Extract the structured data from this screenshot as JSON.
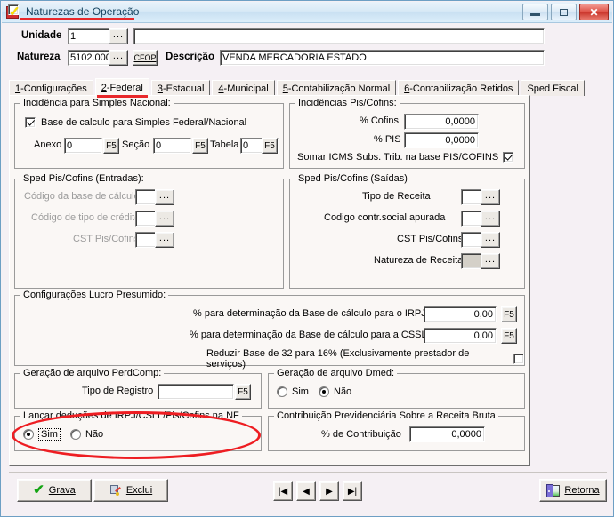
{
  "window": {
    "title": "Naturezas de Operação",
    "icon": "checkmark-flag-icon",
    "minimize_label": "Minimizar",
    "maximize_label": "Maximizar",
    "close_label": "Fechar",
    "accent_red": "#e8282b"
  },
  "header": {
    "unidade_label": "Unidade",
    "unidade_value": "1",
    "unidade_browse": "...",
    "unidade_desc_value": "",
    "natureza_label": "Natureza",
    "natureza_value": "5102.000",
    "natureza_browse": "...",
    "cfop_button": "CFOP",
    "descricao_label": "Descrição",
    "descricao_value": "VENDA MERCADORIA ESTADO"
  },
  "tabs": [
    {
      "num": "1",
      "label": "-Configurações",
      "active": false
    },
    {
      "num": "2",
      "label": "-Federal",
      "active": true
    },
    {
      "num": "3",
      "label": "-Estadual",
      "active": false
    },
    {
      "num": "4",
      "label": "-Municipal",
      "active": false
    },
    {
      "num": "5",
      "label": "-Contabilização Normal",
      "active": false
    },
    {
      "num": "6",
      "label": "-Contabilização Retidos",
      "active": false
    },
    {
      "num": "",
      "label": "Sped Fiscal",
      "active": false
    }
  ],
  "simples_nacional": {
    "legend": "Incidência para Simples Nacional:",
    "base_calculo_label": "Base de calculo para Simples Federal/Nacional",
    "base_calculo_checked": true,
    "anexo_label": "Anexo",
    "anexo_value": "0",
    "anexo_f5": "F5",
    "secao_label": "Seção",
    "secao_value": "0",
    "secao_f5": "F5",
    "tabela_label": "Tabela",
    "tabela_value": "0",
    "tabela_f5": "F5"
  },
  "pis_cofins": {
    "legend": "Incidências Pis/Cofins:",
    "cofins_label": "% Cofins",
    "cofins_value": "0,0000",
    "pis_label": "% PIS",
    "pis_value": "0,0000",
    "somar_label": "Somar ICMS Subs. Trib. na base PIS/COFINS",
    "somar_checked": true
  },
  "sped_entradas": {
    "legend": "Sped Pis/Cofins (Entradas):",
    "base_calc_label": "Código da base de cálculo",
    "base_calc_value": "",
    "tipo_credito_label": "Código de tipo de crédito",
    "tipo_credito_value": "",
    "cst_label": "CST Pis/Cofins",
    "cst_value": "",
    "browse": "...",
    "disabled": true
  },
  "sped_saidas": {
    "legend": "Sped Pis/Cofins (Saídas)",
    "tipo_receita_label": "Tipo de Receita",
    "tipo_receita_value": "",
    "codigo_contr_label": "Codigo contr.social apurada",
    "codigo_contr_value": "",
    "cst_label": "CST Pis/Cofins",
    "cst_value": "",
    "natureza_receita_label": "Natureza de Receita",
    "natureza_receita_value": "",
    "browse": "..."
  },
  "lucro_presumido": {
    "legend": "Configurações Lucro Presumido:",
    "irpj_label": "% para determinação da Base de cálculo para o IRPJ",
    "irpj_value": "0,00",
    "irpj_f5": "F5",
    "cssl_label": "% para determinação da Base de cálculo para a CSSL",
    "cssl_value": "0,00",
    "cssl_f5": "F5",
    "reduzir_label": "Reduzir Base de 32 para 16% (Exclusivamente prestador de serviços)",
    "reduzir_checked": false
  },
  "perdcomp": {
    "legend": "Geração de arquivo PerdComp:",
    "tipo_registro_label": "Tipo de Registro",
    "tipo_registro_value": "",
    "f5": "F5"
  },
  "dmed": {
    "legend": "Geração de arquivo Dmed:",
    "sim_label": "Sim",
    "nao_label": "Não",
    "selected": "Não"
  },
  "lancar_deducoes": {
    "legend": "Lançar deduções de IRPJ/CSLL/Pis/Cofins na NF",
    "sim_label": "Sim",
    "nao_label": "Não",
    "selected": "Sim",
    "highlighted": true
  },
  "contribuicao": {
    "legend": "Contribuição Previdenciária Sobre a Receita Bruta",
    "percent_label": "% de Contribuição",
    "percent_value": "0,0000"
  },
  "toolbar": {
    "grava_label": "Grava",
    "grava_icon": "green-check-icon",
    "exclui_label": "Exclui",
    "exclui_icon": "delete-record-icon",
    "retorna_label": "Retorna",
    "retorna_icon": "exit-door-icon",
    "nav_first": "|◀",
    "nav_prev": "◀",
    "nav_next": "▶",
    "nav_last": "▶|"
  }
}
